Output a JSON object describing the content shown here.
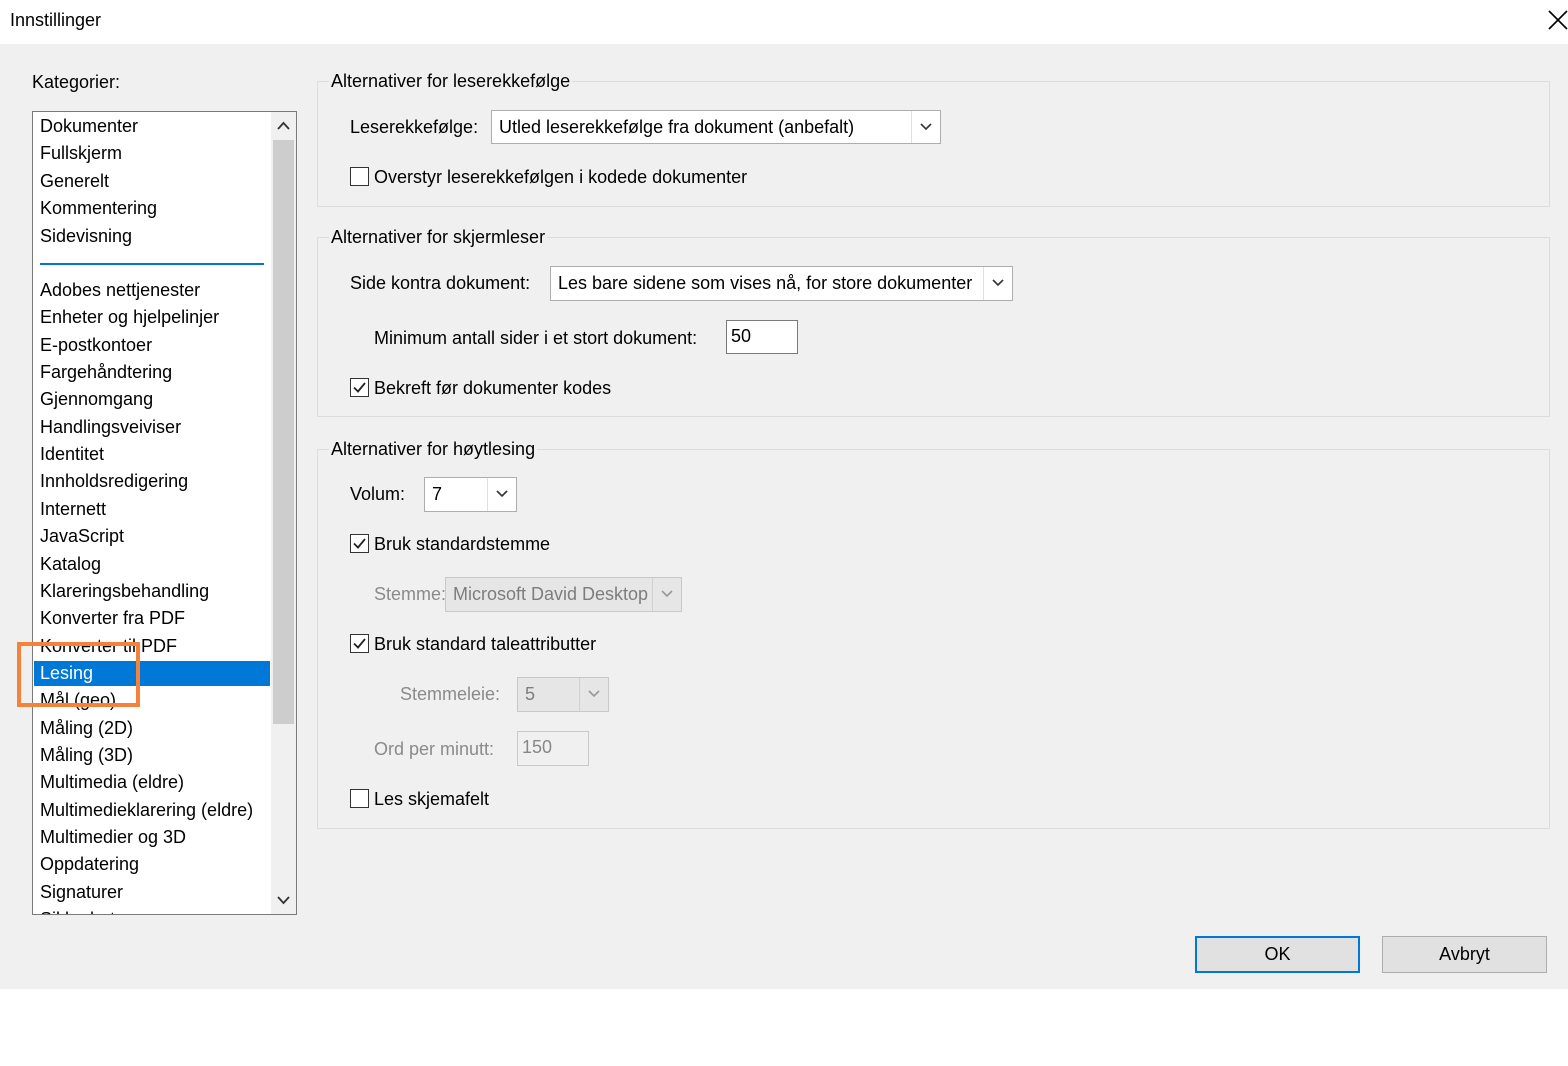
{
  "window": {
    "title": "Innstillinger"
  },
  "categories": {
    "label": "Kategorier:",
    "top_items": [
      "Dokumenter",
      "Fullskjerm",
      "Generelt",
      "Kommentering",
      "Sidevisning"
    ],
    "items": [
      "Adobes nettjenester",
      "Enheter og hjelpelinjer",
      "E-postkontoer",
      "Fargehåndtering",
      "Gjennomgang",
      "Handlingsveiviser",
      "Identitet",
      "Innholdsredigering",
      "Internett",
      "JavaScript",
      "Katalog",
      "Klareringsbehandling",
      "Konverter fra PDF",
      "Konverter til PDF",
      "Lesing",
      "Mål (geo)",
      "Måling (2D)",
      "Måling (3D)",
      "Multimedia (eldre)",
      "Multimedieklarering (eldre)",
      "Multimedier og 3D",
      "Oppdatering",
      "Signaturer",
      "Sikkerhet"
    ],
    "selected": "Lesing"
  },
  "reading_order": {
    "legend": "Alternativer for leserekkefølge",
    "order_label": "Leserekkefølge:",
    "order_value": "Utled leserekkefølge fra dokument (anbefalt)",
    "override_label": "Overstyr leserekkefølgen i kodede dokumenter",
    "override_checked": false
  },
  "screen_reader": {
    "legend": "Alternativer for skjermleser",
    "page_vs_doc_label": "Side kontra dokument:",
    "page_vs_doc_value": "Les bare sidene som vises nå, for store dokumenter",
    "min_pages_label": "Minimum antall sider i et stort dokument:",
    "min_pages_value": "50",
    "confirm_label": "Bekreft før dokumenter kodes",
    "confirm_checked": true
  },
  "read_aloud": {
    "legend": "Alternativer for høytlesing",
    "volume_label": "Volum:",
    "volume_value": "7",
    "default_voice_label": "Bruk standardstemme",
    "default_voice_checked": true,
    "voice_label": "Stemme:",
    "voice_value": "Microsoft David Desktop",
    "default_attr_label": "Bruk standard taleattributter",
    "default_attr_checked": true,
    "pitch_label": "Stemmeleie:",
    "pitch_value": "5",
    "wpm_label": "Ord per minutt:",
    "wpm_value": "150",
    "form_fields_label": "Les skjemafelt",
    "form_fields_checked": false
  },
  "buttons": {
    "ok": "OK",
    "cancel": "Avbryt"
  },
  "colors": {
    "accent": "#0078d7",
    "highlight": "#f5823a"
  }
}
